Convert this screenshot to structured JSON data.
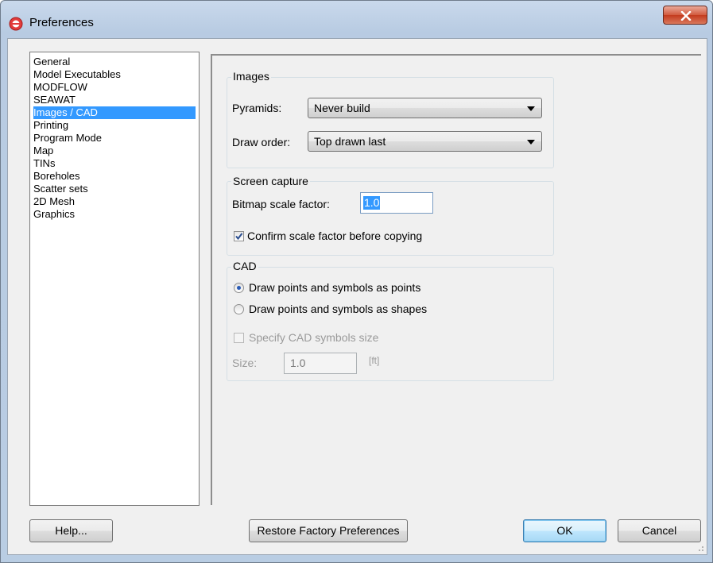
{
  "window": {
    "title": "Preferences",
    "icon": "app-logo-icon",
    "close_icon": "close-icon"
  },
  "categories": [
    {
      "label": "General",
      "selected": false
    },
    {
      "label": "Model Executables",
      "selected": false
    },
    {
      "label": "MODFLOW",
      "selected": false
    },
    {
      "label": "SEAWAT",
      "selected": false
    },
    {
      "label": "Images / CAD",
      "selected": true
    },
    {
      "label": "Printing",
      "selected": false
    },
    {
      "label": "Program Mode",
      "selected": false
    },
    {
      "label": "Map",
      "selected": false
    },
    {
      "label": "TINs",
      "selected": false
    },
    {
      "label": "Boreholes",
      "selected": false
    },
    {
      "label": "Scatter sets",
      "selected": false
    },
    {
      "label": "2D Mesh",
      "selected": false
    },
    {
      "label": "Graphics",
      "selected": false
    }
  ],
  "images_group": {
    "title": "Images",
    "pyramids_label": "Pyramids:",
    "pyramids_value": "Never build",
    "draw_order_label": "Draw order:",
    "draw_order_value": "Top drawn last"
  },
  "screen_capture_group": {
    "title": "Screen capture",
    "bitmap_scale_label": "Bitmap scale factor:",
    "bitmap_scale_value": "1.0",
    "confirm_label": "Confirm scale factor before copying",
    "confirm_checked": true
  },
  "cad_group": {
    "title": "CAD",
    "radio_points_label": "Draw points and symbols as points",
    "radio_points_selected": true,
    "radio_shapes_label": "Draw points and symbols as shapes",
    "radio_shapes_selected": false,
    "specify_size_label": "Specify CAD symbols size",
    "specify_size_checked": false,
    "size_label": "Size:",
    "size_value": "1.0",
    "size_unit": "[ft]"
  },
  "buttons": {
    "help": "Help...",
    "restore": "Restore Factory Preferences",
    "ok": "OK",
    "cancel": "Cancel"
  },
  "colors": {
    "selection": "#3399ff",
    "dialog_bg": "#f0f0f0",
    "titlebar": "#b9cde3",
    "close_button": "#c43b1e"
  }
}
